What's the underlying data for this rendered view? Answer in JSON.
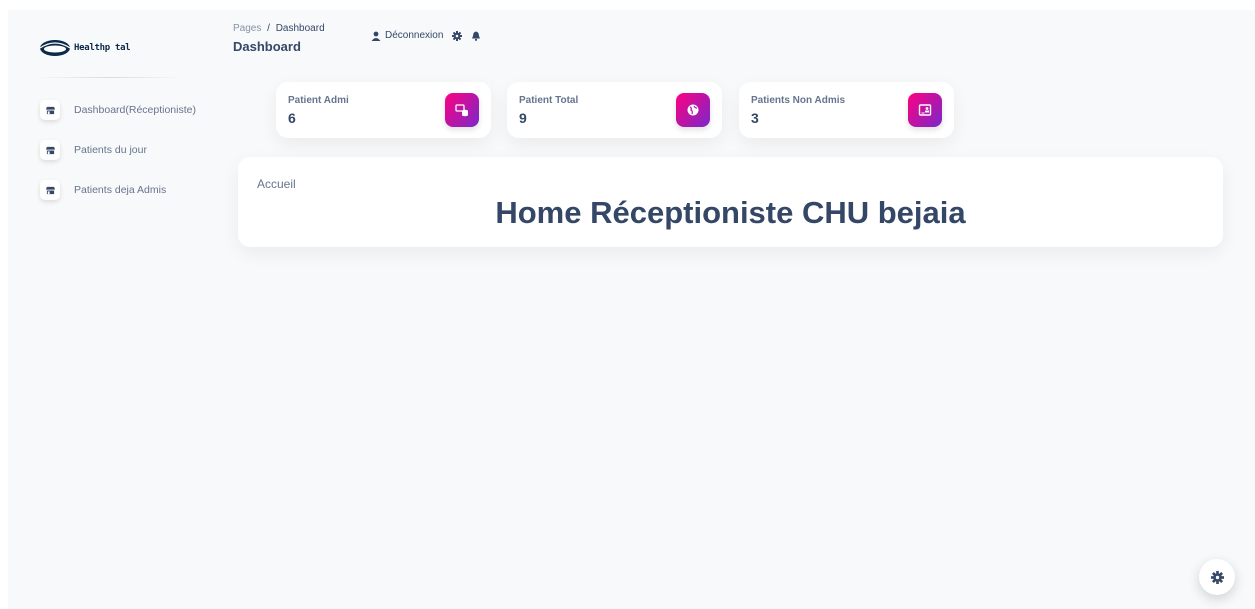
{
  "brand": {
    "name": "Healthp tal"
  },
  "sidebar": {
    "items": [
      {
        "label": "Dashboard(Réceptioniste)",
        "icon": "shop-icon"
      },
      {
        "label": "Patients du jour",
        "icon": "shop-icon"
      },
      {
        "label": "Patients deja Admis",
        "icon": "shop-icon"
      }
    ]
  },
  "breadcrumb": {
    "pages": "Pages",
    "separator": "/",
    "current": "Dashboard"
  },
  "header": {
    "title": "Dashboard",
    "logout_label": "Déconnexion"
  },
  "cards": [
    {
      "label": "Patient Admi",
      "value": "6",
      "icon": "database-icon"
    },
    {
      "label": "Patient Total",
      "value": "9",
      "icon": "globe-icon"
    },
    {
      "label": "Patients Non Admis",
      "value": "3",
      "icon": "contact-card-icon"
    }
  ],
  "panel": {
    "label": "Accueil",
    "heading": "Home Réceptioniste CHU bejaia"
  },
  "colors": {
    "accent_start": "#7928ca",
    "accent_end": "#ff0080",
    "text_dark": "#344767",
    "text_muted": "#67748e"
  }
}
